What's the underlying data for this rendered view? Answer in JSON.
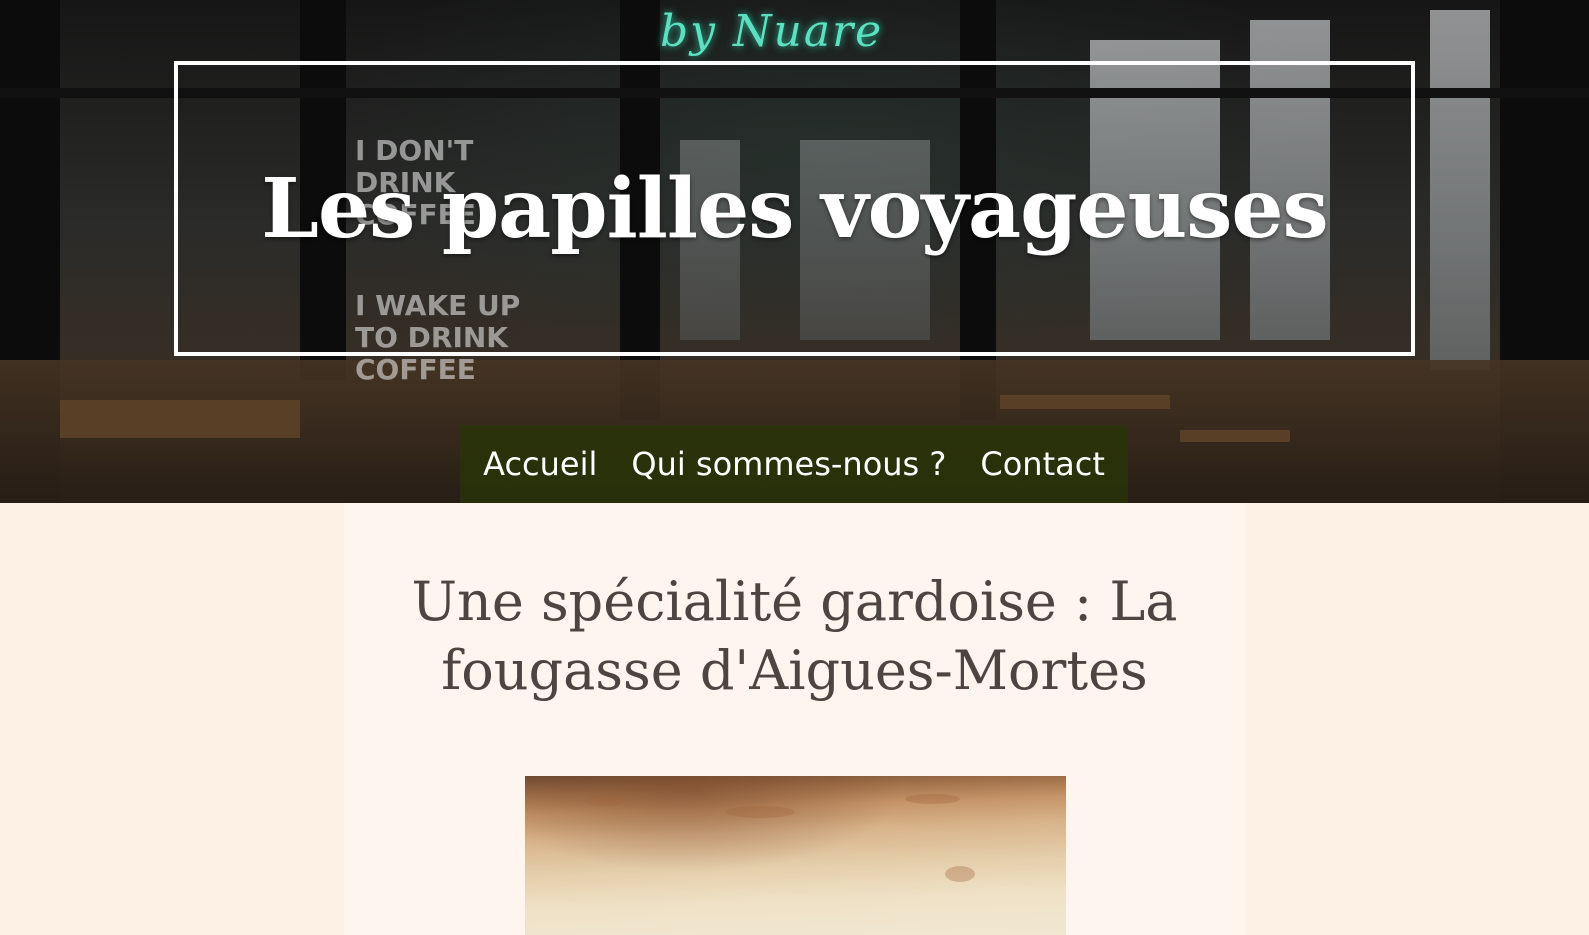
{
  "header": {
    "site_title": "Les papilles voyageuses",
    "neon_sign": "by Nuare"
  },
  "nav": {
    "items": [
      {
        "label": "Accueil"
      },
      {
        "label": "Qui sommes-nous ?"
      },
      {
        "label": "Contact"
      }
    ]
  },
  "article": {
    "title": "Une spécialité gardoise : La fougasse d'Aigues-Mortes",
    "image_subject": "fougasse d'Aigues-Mortes"
  },
  "colors": {
    "page_background": "#fdf0e4",
    "content_background": "#fff5ef",
    "title_text": "#4c4541",
    "nav_background": "#28340a",
    "neon": "#5de0c2"
  }
}
